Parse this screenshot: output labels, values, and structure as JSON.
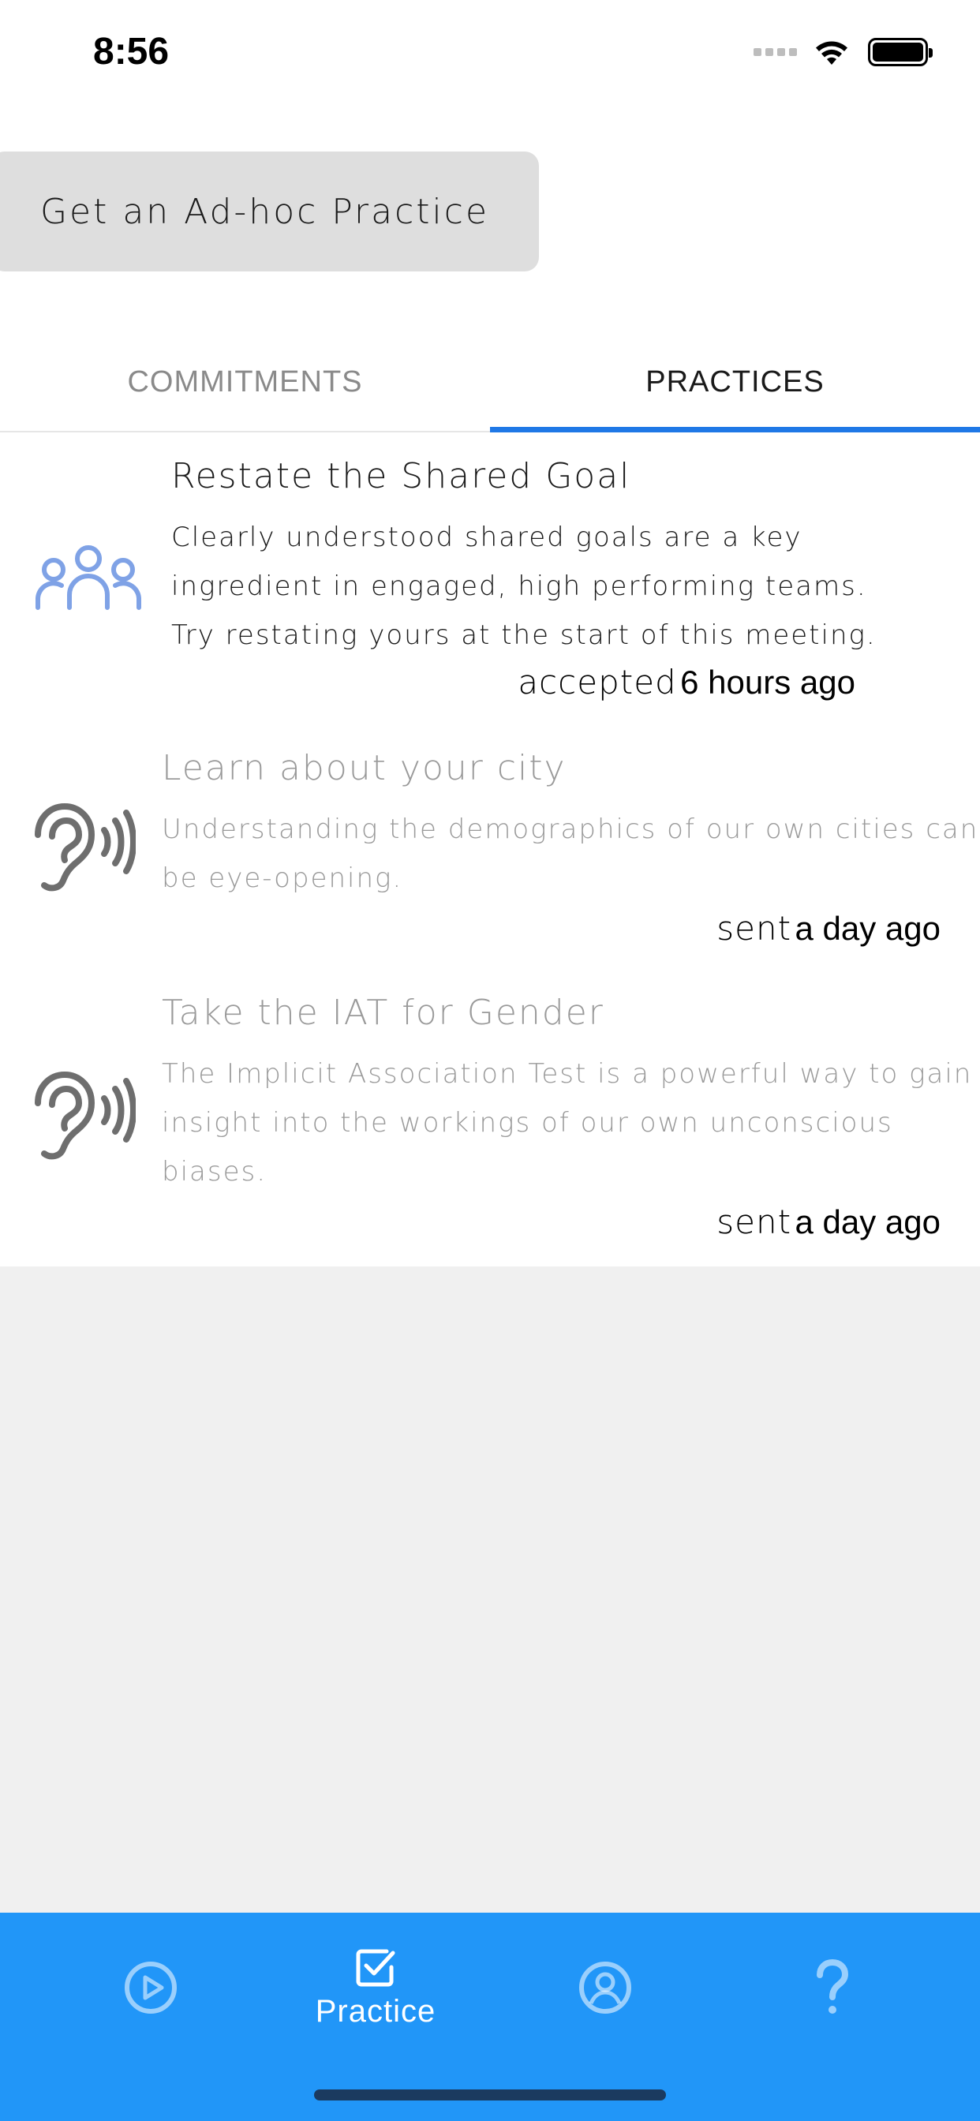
{
  "status_bar": {
    "time": "8:56"
  },
  "adhoc_button": {
    "label": "Get an Ad-hoc Practice"
  },
  "tabs": [
    {
      "label": "COMMITMENTS",
      "selected": false
    },
    {
      "label": "PRACTICES",
      "selected": true
    }
  ],
  "practices": [
    {
      "icon": "team-icon",
      "title": "Restate the Shared Goal",
      "desc_lines": [
        "Clearly understood shared goals are a key",
        "ingredient in engaged, high performing teams.",
        "Try restating yours at the start of this meeting."
      ],
      "status_verb": "accepted",
      "status_time": "6 hours ago"
    },
    {
      "icon": "ear-icon",
      "title": "Learn about your city",
      "desc_lines": [
        "Understanding the demographics of our own cities can",
        "be eye-opening."
      ],
      "status_verb": "sent",
      "status_time": "a day ago"
    },
    {
      "icon": "ear-icon",
      "title": "Take the IAT for Gender",
      "desc_lines": [
        "The Implicit Association Test is a powerful way to gain",
        "insight into the workings of our own unconscious",
        "biases."
      ],
      "status_verb": "sent",
      "status_time": "a day ago"
    }
  ],
  "tab_bar": {
    "items": [
      {
        "icon": "play-circle-icon",
        "label": ""
      },
      {
        "icon": "checkbox-icon",
        "label": "Practice"
      },
      {
        "icon": "profile-icon",
        "label": ""
      },
      {
        "icon": "question-icon",
        "label": ""
      }
    ]
  },
  "colors": {
    "accent": "#1f78e6",
    "tab_bar": "#2196f8",
    "team_icon": "#7fa2e6",
    "ear_icon": "#6e6e6e"
  }
}
